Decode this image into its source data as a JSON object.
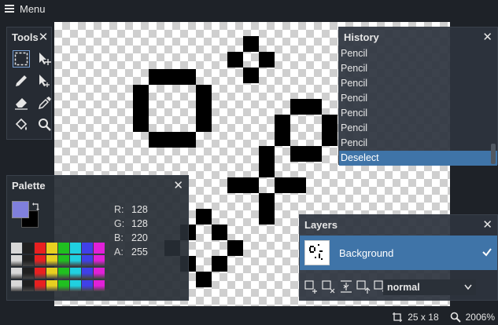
{
  "menu": {
    "label": "Menu"
  },
  "tools_panel": {
    "title": "Tools",
    "close": "✕"
  },
  "history_panel": {
    "title": "History",
    "close": "✕",
    "items": [
      "Pencil",
      "Pencil",
      "Pencil",
      "Pencil",
      "Pencil",
      "Pencil",
      "Pencil",
      "Deselect"
    ],
    "selected_index": 7
  },
  "palette_panel": {
    "title": "Palette",
    "close": "✕",
    "primary_color": "#8080dc",
    "secondary_color": "#000000",
    "rgba": [
      {
        "label": "R:",
        "value": "128"
      },
      {
        "label": "G:",
        "value": "128"
      },
      {
        "label": "B:",
        "value": "220"
      },
      {
        "label": "A:",
        "value": "255"
      }
    ]
  },
  "layers_panel": {
    "title": "Layers",
    "close": "✕",
    "layer_name": "Background",
    "blend_mode": "normal"
  },
  "status": {
    "canvas_size": "25 x 18",
    "zoom": "2006%"
  }
}
